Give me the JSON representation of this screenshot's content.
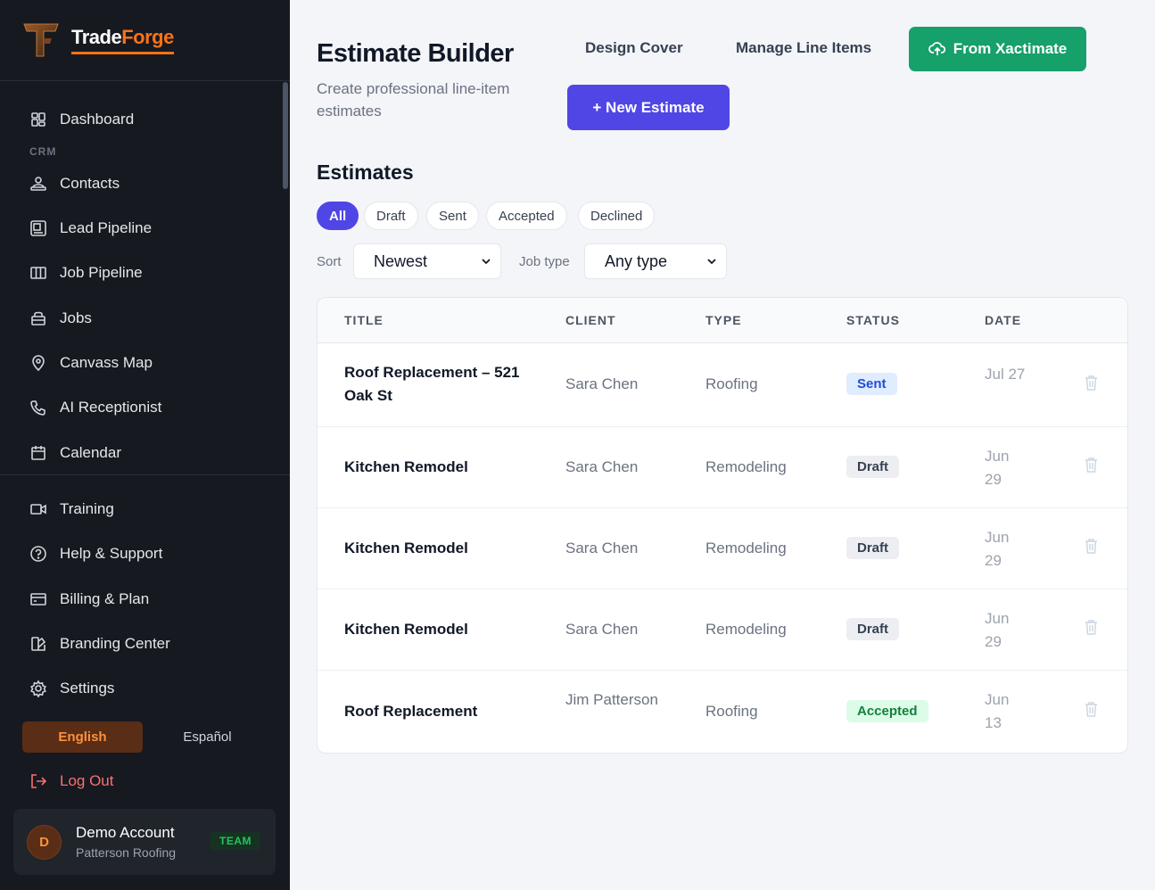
{
  "brand": {
    "name_part1": "Trade",
    "name_part2": "Forge"
  },
  "sidebar": {
    "section_label": "CRM",
    "items": [
      {
        "label": "Dashboard",
        "icon": "grid-icon"
      },
      {
        "label": "Contacts",
        "icon": "contacts-icon"
      },
      {
        "label": "Lead Pipeline",
        "icon": "lead-icon"
      },
      {
        "label": "Job Pipeline",
        "icon": "columns-icon"
      },
      {
        "label": "Jobs",
        "icon": "briefcase-icon"
      },
      {
        "label": "Canvass Map",
        "icon": "map-pin-icon"
      },
      {
        "label": "AI Receptionist",
        "icon": "phone-icon"
      },
      {
        "label": "Calendar",
        "icon": "calendar-icon"
      },
      {
        "label": "Training",
        "icon": "video-icon"
      },
      {
        "label": "Help & Support",
        "icon": "help-icon"
      },
      {
        "label": "Billing & Plan",
        "icon": "credit-card-icon"
      },
      {
        "label": "Branding Center",
        "icon": "palette-icon"
      },
      {
        "label": "Settings",
        "icon": "gear-icon"
      }
    ],
    "languages": {
      "active": "English",
      "other": "Español"
    },
    "logout": "Log Out",
    "account": {
      "initial": "D",
      "name": "Demo Account",
      "company": "Patterson Roofing",
      "badge": "TEAM"
    }
  },
  "header": {
    "title": "Estimate Builder",
    "subtitle": "Create professional line-item estimates",
    "design_cover": "Design Cover",
    "manage_line_items": "Manage Line Items",
    "from_xactimate": "From Xactimate",
    "new_estimate": "+ New Estimate"
  },
  "estimates": {
    "title": "Estimates",
    "filters": [
      "All",
      "Draft",
      "Sent",
      "Accepted",
      "Declined"
    ],
    "active_filter": "All",
    "sort_label": "Sort",
    "sort_value": "Newest",
    "jobtype_label": "Job type",
    "jobtype_value": "Any type",
    "columns": [
      "TITLE",
      "CLIENT",
      "TYPE",
      "STATUS",
      "DATE"
    ],
    "rows": [
      {
        "title": "Roof Replacement – 521 Oak St",
        "client": "Sara Chen",
        "type": "Roofing",
        "status": "Sent",
        "date": "Jul 27"
      },
      {
        "title": "Kitchen Remodel",
        "client": "Sara Chen",
        "type": "Remodeling",
        "status": "Draft",
        "date": "Jun 29"
      },
      {
        "title": "Kitchen Remodel",
        "client": "Sara Chen",
        "type": "Remodeling",
        "status": "Draft",
        "date": "Jun 29"
      },
      {
        "title": "Kitchen Remodel",
        "client": "Sara Chen",
        "type": "Remodeling",
        "status": "Draft",
        "date": "Jun 29"
      },
      {
        "title": "Roof Replacement",
        "client": "Jim Patterson",
        "type": "Roofing",
        "status": "Accepted",
        "date": "Jun 13"
      }
    ]
  },
  "colors": {
    "accent": "#4f46e5",
    "brand": "#f97316",
    "success": "#16a06a",
    "sidebar_bg": "#16191f"
  }
}
